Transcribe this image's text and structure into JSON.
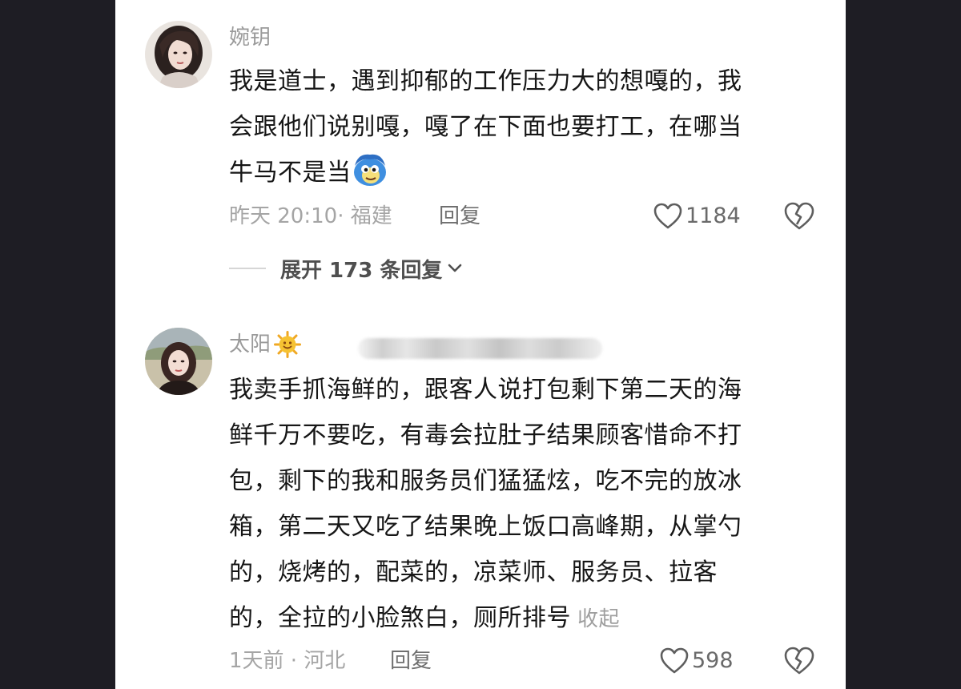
{
  "comments": [
    {
      "username": "婉钥",
      "lines": [
        "我是道士，遇到抑郁的工作压力大的想嘎的，我",
        "会跟他们说别嘎，嘎了在下面也要打工，在哪当",
        "牛马不是当"
      ],
      "meta": "昨天 20:10· 福建",
      "reply_label": "回复",
      "likes": "1184",
      "expand_label": "展开 173 条回复"
    },
    {
      "username": "太阳",
      "lines": [
        "我卖手抓海鲜的，跟客人说打包剩下第二天的海",
        "鲜千万不要吃，有毒会拉肚子结果顾客惜命不打",
        "包，剩下的我和服务员们猛猛炫，吃不完的放冰",
        "箱，第二天又吃了结果晚上饭口高峰期，从掌勺",
        "的，烧烤的，配菜的，凉菜师、服务员、拉客",
        "的，全拉的小脸煞白，厕所排号"
      ],
      "collapse_label": "收起",
      "meta": "1天前 · 河北",
      "reply_label": "回复",
      "likes": "598"
    }
  ],
  "icons": {
    "like": "heart-outline-icon",
    "dislike": "broken-heart-icon",
    "expand": "chevron-down-icon",
    "emoji_1": "blue-face-emoji",
    "emoji_2": "sun-face-emoji"
  },
  "colors": {
    "background": "#1e1d24",
    "panel": "#ffffff",
    "text": "#161616",
    "muted": "#a5a5a5"
  }
}
